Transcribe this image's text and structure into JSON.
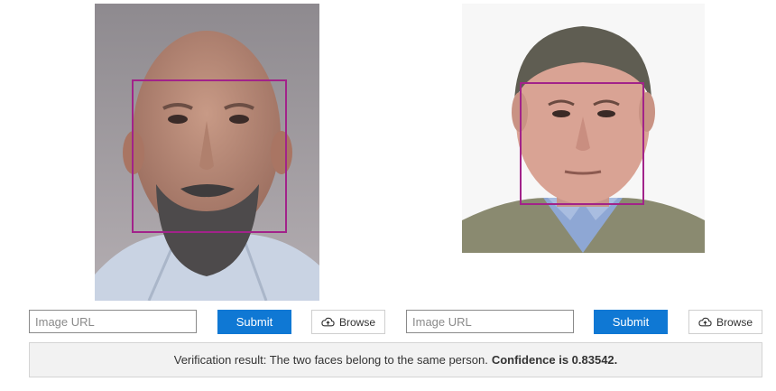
{
  "photos": [
    {
      "alt": "face-photo-1",
      "accent": "#a2238a"
    },
    {
      "alt": "face-photo-2",
      "accent": "#a2238a"
    }
  ],
  "left_panel": {
    "url_placeholder": "Image URL",
    "submit_label": "Submit",
    "browse_label": "Browse"
  },
  "right_panel": {
    "url_placeholder": "Image URL",
    "submit_label": "Submit",
    "browse_label": "Browse"
  },
  "result": {
    "text": "Verification result: The two faces belong to the same person.",
    "confidence": "Confidence is 0.83542."
  },
  "colors": {
    "face_box": "#a2238a",
    "submit_bg": "#0f78d4",
    "result_bg": "#f2f2f2"
  },
  "icons": {
    "browse": "cloud-upload-icon"
  }
}
